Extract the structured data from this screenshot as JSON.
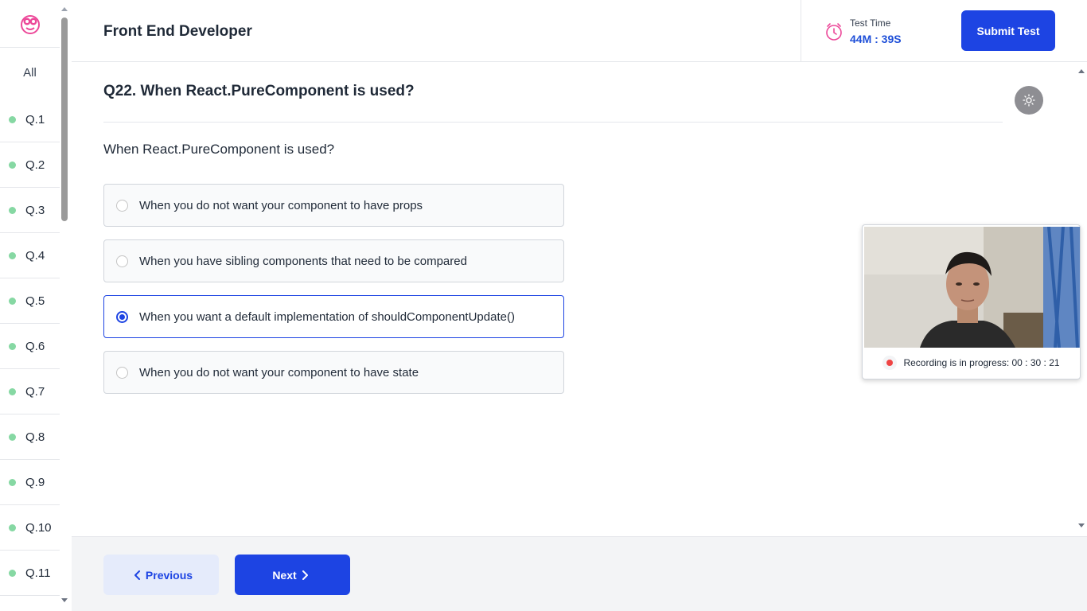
{
  "header": {
    "title": "Front End Developer",
    "timer_label": "Test Time",
    "timer_value": "44M : 39S",
    "submit_label": "Submit Test"
  },
  "sidebar": {
    "all_label": "All",
    "questions": [
      "Q.1",
      "Q.2",
      "Q.3",
      "Q.4",
      "Q.5",
      "Q.6",
      "Q.7",
      "Q.8",
      "Q.9",
      "Q.10",
      "Q.11"
    ],
    "status_color": "#86d8a3"
  },
  "question": {
    "title": "Q22. When React.PureComponent is used?",
    "text": "When React.PureComponent is used?",
    "options": [
      {
        "label": "When you do not want your component to have props",
        "selected": false
      },
      {
        "label": "When you have sibling components that need to be compared",
        "selected": false
      },
      {
        "label": "When you want a default implementation of shouldComponentUpdate()",
        "selected": true
      },
      {
        "label": "When you do not want your component to have state",
        "selected": false
      }
    ]
  },
  "webcam": {
    "recording_text": "Recording is in progress: 00 : 30 : 21"
  },
  "footer": {
    "previous_label": "Previous",
    "next_label": "Next"
  },
  "colors": {
    "accent": "#1d44e3",
    "timer_icon": "#ec4899",
    "recording": "#ef4444"
  },
  "icons": {
    "logo": "logo-icon",
    "timer": "clock-icon",
    "theme": "sun-icon",
    "prev": "chevron-left-icon",
    "next": "chevron-right-icon"
  }
}
